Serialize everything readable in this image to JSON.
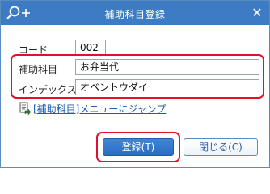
{
  "window": {
    "title": "補助科目登録",
    "close_glyph": "✕"
  },
  "form": {
    "code_label": "コード",
    "code_value": "002",
    "name_label": "補助科目",
    "name_value": "お弁当代",
    "index_label": "インデックス",
    "index_value": "オベントウダイ"
  },
  "link": {
    "text": "[補助科目]メニューにジャンプ",
    "icon": "jump-icon"
  },
  "buttons": {
    "register": "登録(T)",
    "close": "閉じる(C)"
  },
  "colors": {
    "titlebar": "#3d7cc4",
    "highlight": "#e0112b",
    "link": "#1a5fb4",
    "primary_button": "#2b6cc1"
  }
}
